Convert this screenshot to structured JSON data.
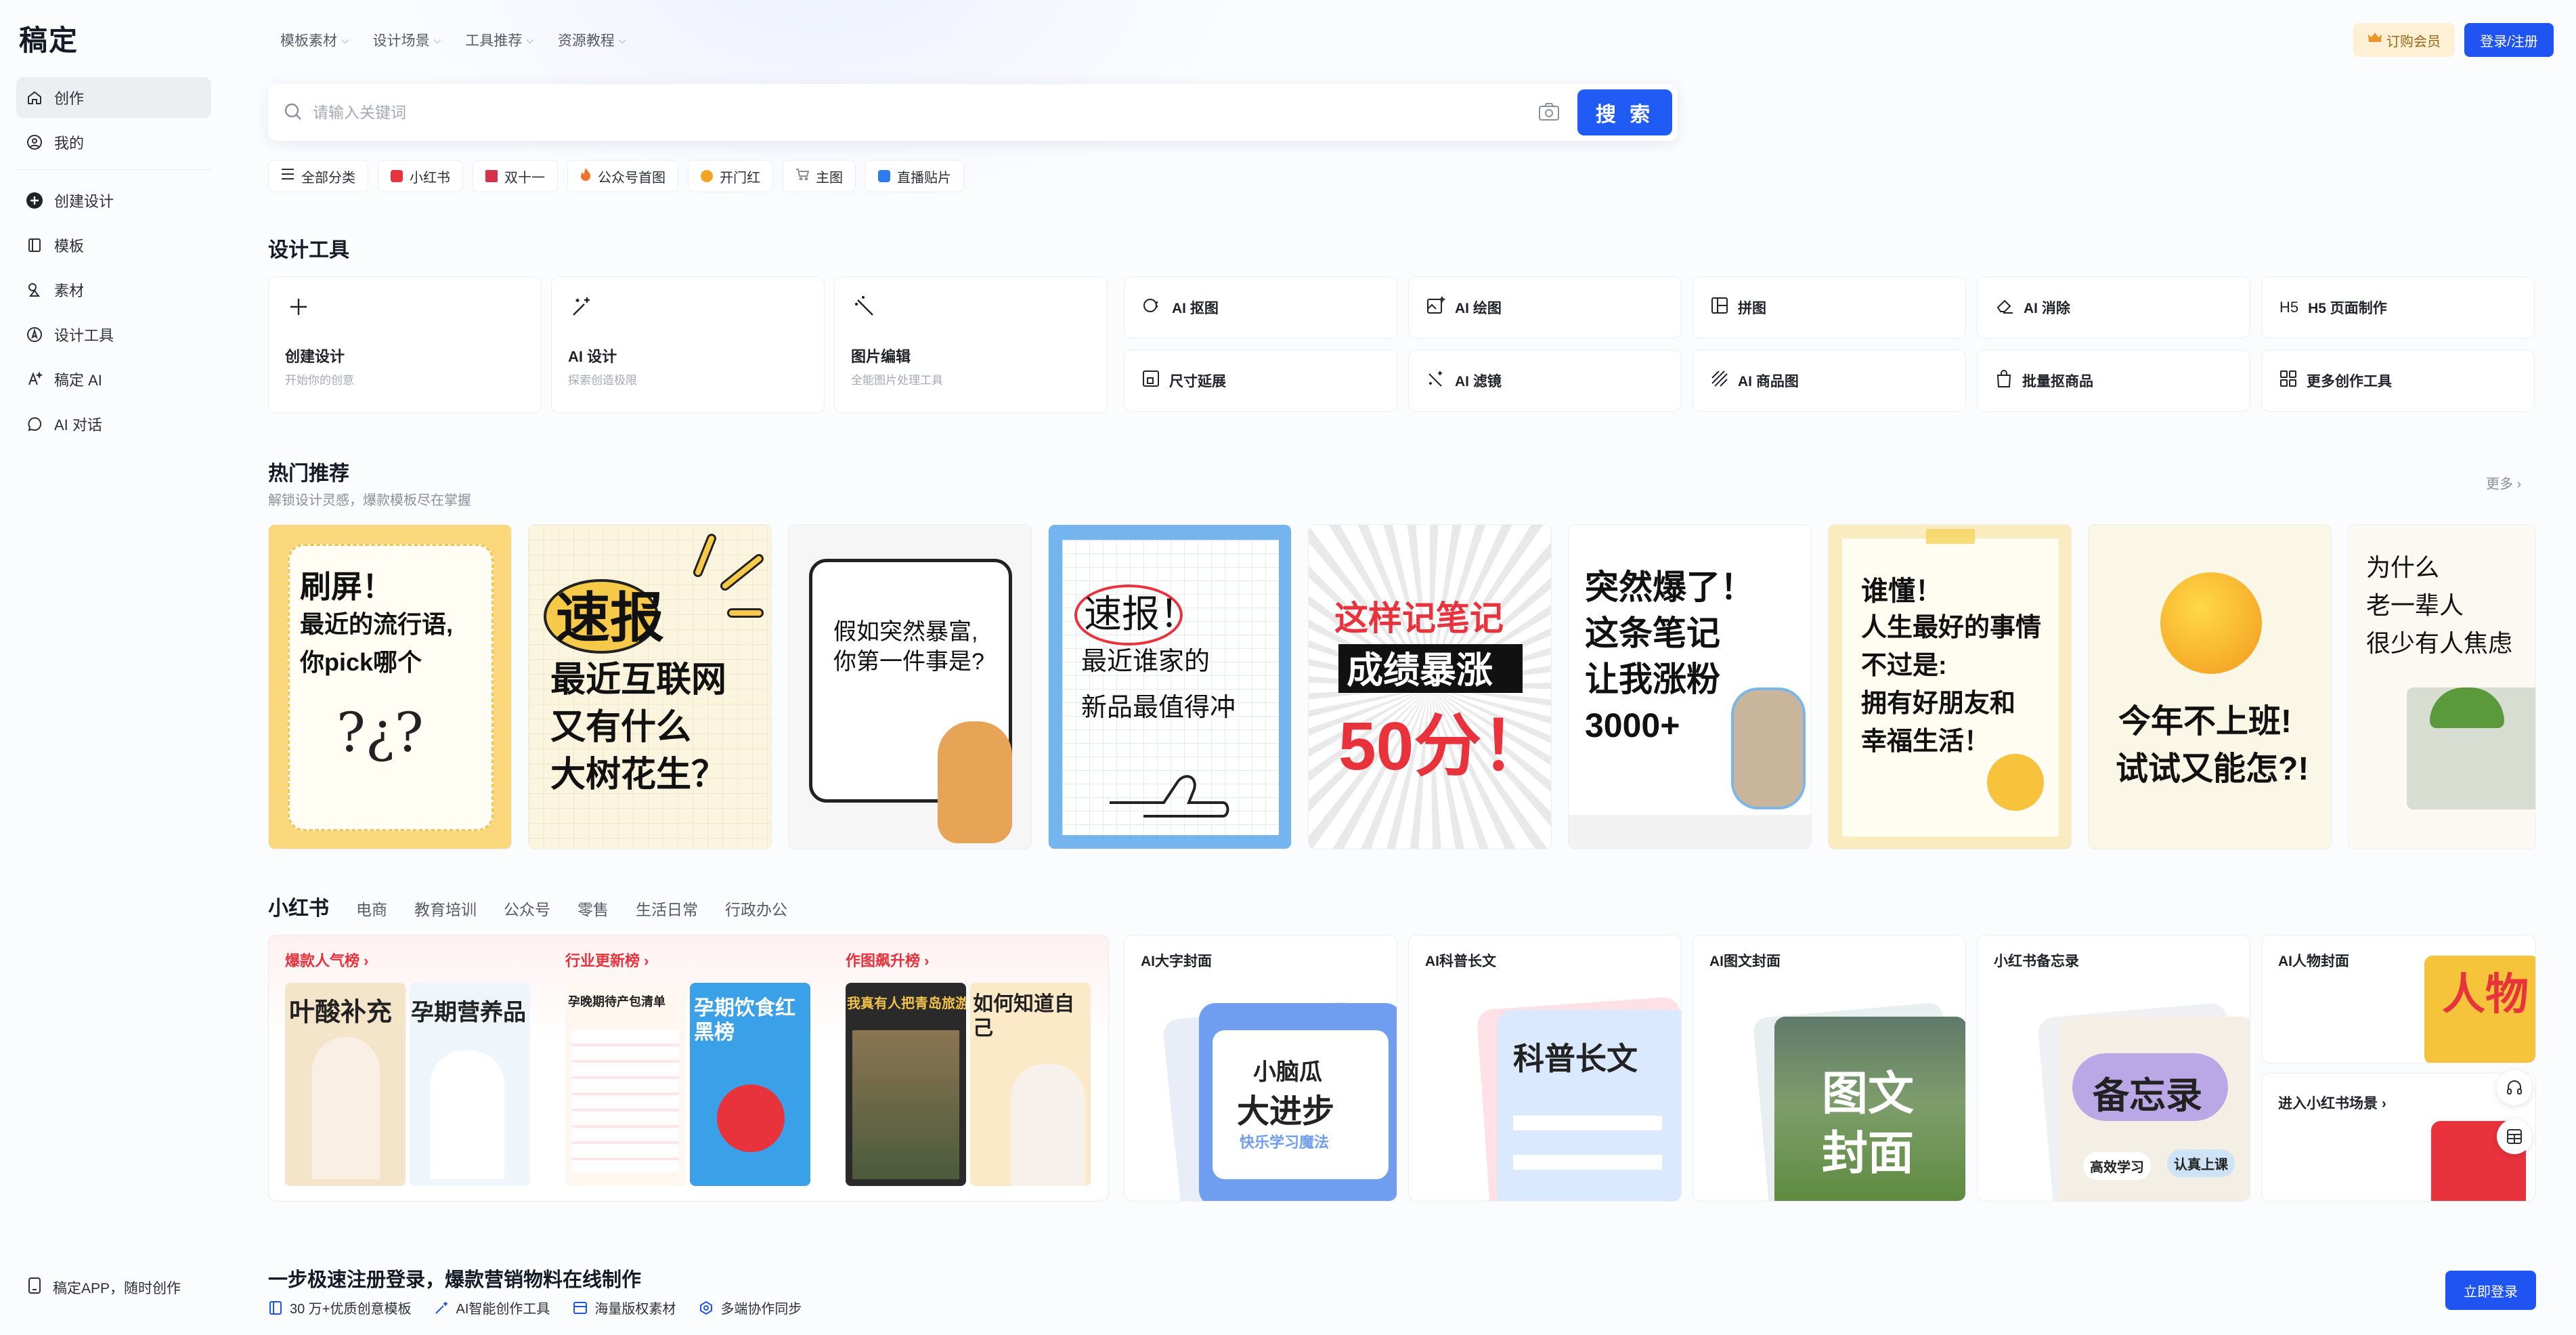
{
  "brand": {
    "logo": "稿定"
  },
  "sidebar": {
    "top_items": [
      {
        "label": "创作",
        "icon": "home-icon"
      },
      {
        "label": "我的",
        "icon": "user-icon"
      }
    ],
    "items": [
      {
        "label": "创建设计",
        "icon": "plus-circle-icon"
      },
      {
        "label": "模板",
        "icon": "template-icon"
      },
      {
        "label": "素材",
        "icon": "shapes-icon"
      },
      {
        "label": "设计工具",
        "icon": "compass-icon"
      },
      {
        "label": "稿定 AI",
        "icon": "ai-icon"
      },
      {
        "label": "AI 对话",
        "icon": "chat-icon"
      }
    ],
    "bottom": "稿定APP，随时创作"
  },
  "topnav": {
    "items": [
      "模板素材",
      "设计场景",
      "工具推荐",
      "资源教程"
    ],
    "vip": "订购会员",
    "login": "登录/注册"
  },
  "search": {
    "placeholder": "请输入关键词",
    "button": "搜 索"
  },
  "chips": [
    {
      "label": "全部分类",
      "color": "#555b66"
    },
    {
      "label": "小红书",
      "color": "#e8323c"
    },
    {
      "label": "双十一",
      "color": "#d8324a"
    },
    {
      "label": "公众号首图",
      "color": "#f2702a"
    },
    {
      "label": "开门红",
      "color": "#f2a425"
    },
    {
      "label": "主图",
      "color": "#8a9099"
    },
    {
      "label": "直播贴片",
      "color": "#2f7cf0"
    }
  ],
  "tools": {
    "title": "设计工具",
    "big": [
      {
        "title": "创建设计",
        "sub": "开始你的创意"
      },
      {
        "title": "AI 设计",
        "sub": "探索创造极限"
      },
      {
        "title": "图片编辑",
        "sub": "全能图片处理工具"
      }
    ],
    "small_row1": [
      "AI 抠图",
      "AI 绘图",
      "拼图",
      "AI 消除",
      "H5 页面制作"
    ],
    "small_row2": [
      "尺寸延展",
      "AI 滤镜",
      "AI 商品图",
      "批量抠商品",
      "更多创作工具"
    ]
  },
  "hot": {
    "title": "热门推荐",
    "subtitle": "解锁设计灵感，爆款模板尽在掌握",
    "more": "更多 ›",
    "cards": [
      {
        "lines": [
          "刷屏！",
          "最近的流行语,",
          "你pick哪个"
        ]
      },
      {
        "lines": [
          "速报",
          "最近互联网",
          "又有什么",
          "大树花生？"
        ]
      },
      {
        "lines": [
          "假如突然暴富,",
          "你第一件事是?"
        ]
      },
      {
        "lines": [
          "速报！",
          "最近谁家的",
          "新品最值得冲"
        ]
      },
      {
        "lines": [
          "这样记笔记",
          "成绩暴涨",
          "50分！"
        ]
      },
      {
        "lines": [
          "突然爆了！",
          "这条笔记",
          "让我涨粉",
          "3000+"
        ]
      },
      {
        "lines": [
          "谁懂！",
          "人生最好的事情",
          "不过是:",
          "拥有好朋友和",
          "幸福生活！"
        ]
      },
      {
        "lines": [
          "今年不上班!",
          "试试又能怎?!"
        ]
      },
      {
        "lines": [
          "为什么",
          "老一辈人",
          "很少有人焦虑"
        ]
      }
    ]
  },
  "xhs": {
    "tabs": [
      "小红书",
      "电商",
      "教育培训",
      "公众号",
      "零售",
      "生活日常",
      "行政办公"
    ],
    "ranks": [
      {
        "title": "爆款人气榜 ›",
        "img_text": [
          "叶酸补充",
          "孕期营养品"
        ]
      },
      {
        "title": "行业更新榜 ›",
        "img_text": [
          "孕晚期待产包清单",
          "孕期饮食红黑榜"
        ]
      },
      {
        "title": "作图飙升榜 ›",
        "img_text": [
          "我真有人把青岛旅游",
          "如何知道自己"
        ]
      }
    ],
    "cards": [
      {
        "title": "AI大字封面",
        "img_text": [
          "小脑瓜",
          "大进步",
          "快乐学习魔法"
        ]
      },
      {
        "title": "AI科普长文",
        "img_text": [
          "科普长文"
        ]
      },
      {
        "title": "AI图文封面",
        "img_text": [
          "图文",
          "封面"
        ]
      },
      {
        "title": "小红书备忘录",
        "img_text": [
          "备忘录",
          "高效学习",
          "认真上课"
        ]
      },
      {
        "title": "AI人物封面",
        "img_text": [
          "人物"
        ],
        "enter": "进入小红书场景 ›"
      }
    ]
  },
  "banner": {
    "title": "一步极速注册登录，爆款营销物料在线制作",
    "features": [
      "30 万+优质创意模板",
      "AI智能创作工具",
      "海量版权素材",
      "多端协作同步"
    ],
    "button": "立即登录"
  }
}
